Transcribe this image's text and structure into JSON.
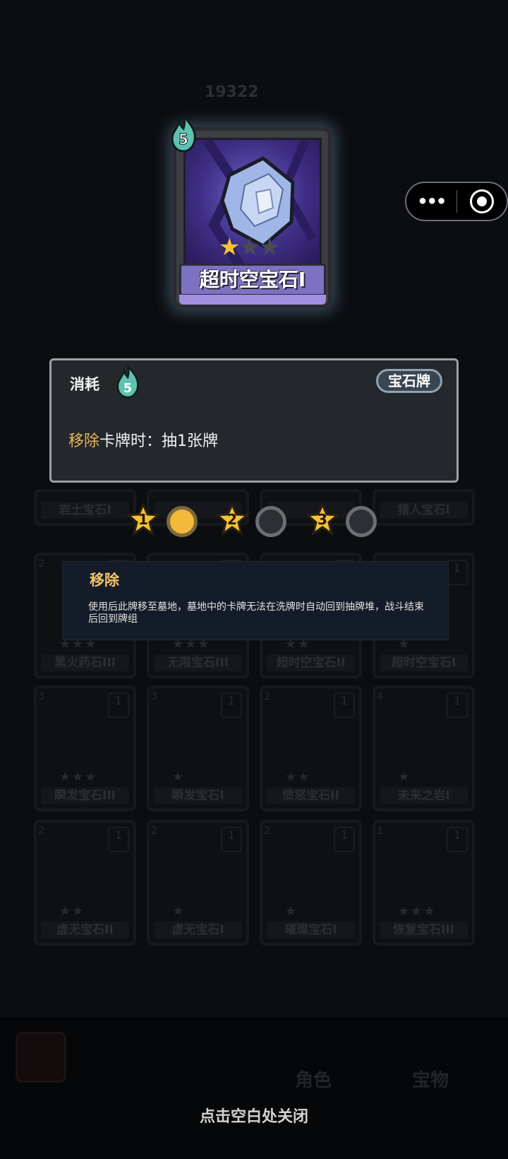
{
  "background": {
    "score": "19322",
    "cards": [
      {
        "name": "岩土宝石I",
        "stars": "★",
        "cost": ""
      },
      {
        "name": "",
        "stars": "",
        "cost": ""
      },
      {
        "name": "",
        "stars": "",
        "cost": ""
      },
      {
        "name": "猎人宝石I",
        "stars": "★★",
        "cost": ""
      },
      {
        "name": "黑火药石III",
        "stars": "★★★",
        "cost": "2"
      },
      {
        "name": "无限宝石III",
        "stars": "★★★",
        "cost": ""
      },
      {
        "name": "超时空宝石II",
        "stars": "★★",
        "cost": ""
      },
      {
        "name": "超时空宝石I",
        "stars": "★",
        "cost": ""
      },
      {
        "name": "瞬发宝石III",
        "stars": "★★★",
        "cost": "3"
      },
      {
        "name": "瞬发宝石I",
        "stars": "★",
        "cost": "3"
      },
      {
        "name": "愤怒宝石II",
        "stars": "★★",
        "cost": "2"
      },
      {
        "name": "未来之岩I",
        "stars": "★",
        "cost": "4"
      },
      {
        "name": "虚无宝石II",
        "stars": "★★",
        "cost": "2"
      },
      {
        "name": "虚无宝石I",
        "stars": "★",
        "cost": "2"
      },
      {
        "name": "璀璨宝石I",
        "stars": "★",
        "cost": "2"
      },
      {
        "name": "恢复宝石III",
        "stars": "★★★",
        "cost": "1"
      }
    ],
    "stack_count": "1",
    "bottom_buttons": [
      "角色",
      "宝物"
    ]
  },
  "capsule": {
    "more_icon": "more-dots-icon",
    "close_icon": "target-icon"
  },
  "card": {
    "cost": "5",
    "title": "超时空宝石I",
    "stars_total": 3,
    "stars_filled": 1,
    "colors": {
      "frame_glow": "#8cbee6",
      "title_bar": "#7d72c2",
      "star_on": "#f5c234"
    }
  },
  "info": {
    "keyword": "消耗",
    "cost": "5",
    "tag": "宝石牌",
    "desc_highlight": "移除",
    "desc_rest": "卡牌时：抽1张牌"
  },
  "levels": [
    {
      "label": "1",
      "selected": true
    },
    {
      "label": "2",
      "selected": false
    },
    {
      "label": "3",
      "selected": false
    }
  ],
  "tooltip": {
    "title": "移除",
    "body": "使用后此牌移至墓地，墓地中的卡牌无法在洗牌时自动回到抽牌堆，战斗结束后回到牌组"
  },
  "close_hint": "点击空白处关闭"
}
